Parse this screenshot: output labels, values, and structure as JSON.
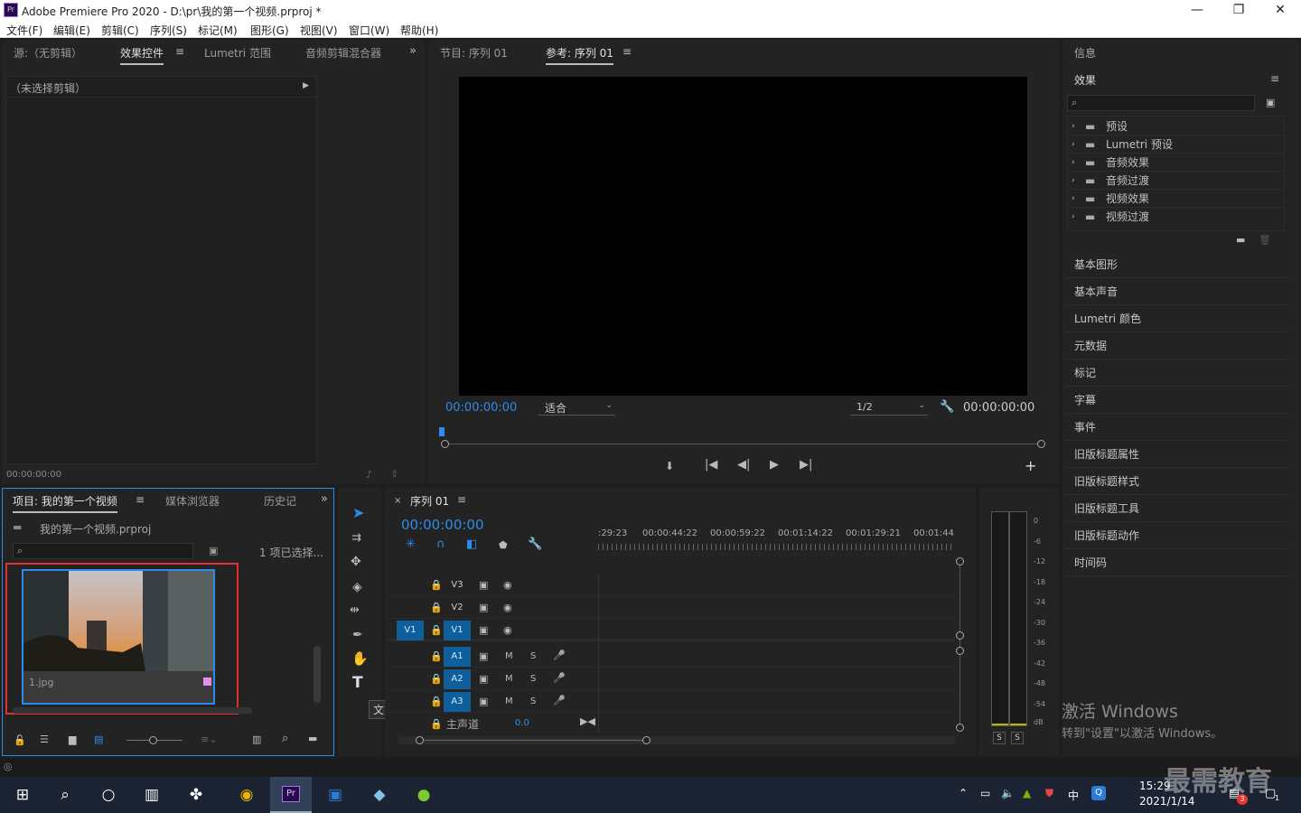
{
  "window": {
    "title": "Adobe Premiere Pro 2020 - D:\\pr\\我的第一个视频.prproj *"
  },
  "menu": [
    "文件(F)",
    "编辑(E)",
    "剪辑(C)",
    "序列(S)",
    "标记(M)",
    "图形(G)",
    "视图(V)",
    "窗口(W)",
    "帮助(H)"
  ],
  "source_panel": {
    "tabs": [
      "源:（无剪辑）",
      "效果控件",
      "Lumetri 范围",
      "音频剪辑混合器"
    ],
    "no_clip": "（未选择剪辑）",
    "timecode": "00:00:00:00"
  },
  "program_panel": {
    "tabs": [
      "节目: 序列 01",
      "参考: 序列 01"
    ],
    "timecode_left": "00:00:00:00",
    "zoom": "适合",
    "resolution": "1/2",
    "timecode_right": "00:00:00:00"
  },
  "project_panel": {
    "tabs": [
      "项目: 我的第一个视频",
      "媒体浏览器",
      "历史记"
    ],
    "file": "我的第一个视频.prproj",
    "selected": "1 项已选择...",
    "clip_name": "1.jpg"
  },
  "timeline": {
    "seq_tab": "序列 01",
    "timecode": "00:00:00:00",
    "ruler": [
      ":29:23",
      "00:00:44:22",
      "00:00:59:22",
      "00:01:14:22",
      "00:01:29:21",
      "00:01:44:"
    ],
    "video_tracks": [
      "V3",
      "V2",
      "V1"
    ],
    "source_patch": "V1",
    "audio_tracks": [
      "A1",
      "A2",
      "A3"
    ],
    "master": "主声道",
    "master_value": "0.0",
    "tooltip": "文字工具 (T)"
  },
  "meter": {
    "labels": [
      "0",
      "-6",
      "-12",
      "-18",
      "-24",
      "-30",
      "-36",
      "-42",
      "-48",
      "-54",
      "dB"
    ],
    "solo": [
      "S",
      "S"
    ]
  },
  "right_panel": {
    "info": "信息",
    "effects_title": "效果",
    "effects": [
      "预设",
      "Lumetri 预设",
      "音频效果",
      "音频过渡",
      "视频效果",
      "视频过渡"
    ],
    "items": [
      "基本图形",
      "基本声音",
      "Lumetri 颜色",
      "元数据",
      "标记",
      "字幕",
      "事件",
      "旧版标题属性",
      "旧版标题样式",
      "旧版标题工具",
      "旧版标题动作",
      "时间码"
    ]
  },
  "watermark": {
    "line1": "激活 Windows",
    "line2": "转到\"设置\"以激活 Windows。"
  },
  "taskbar": {
    "time": "15:29",
    "date": "2021/1/14",
    "ime": "中",
    "brand": "最需教育",
    "badge": "3",
    "notif": "1"
  },
  "colors": {
    "accent": "#2d8ceb",
    "highlight": "#e03030",
    "track_on": "#0f5f9c"
  }
}
